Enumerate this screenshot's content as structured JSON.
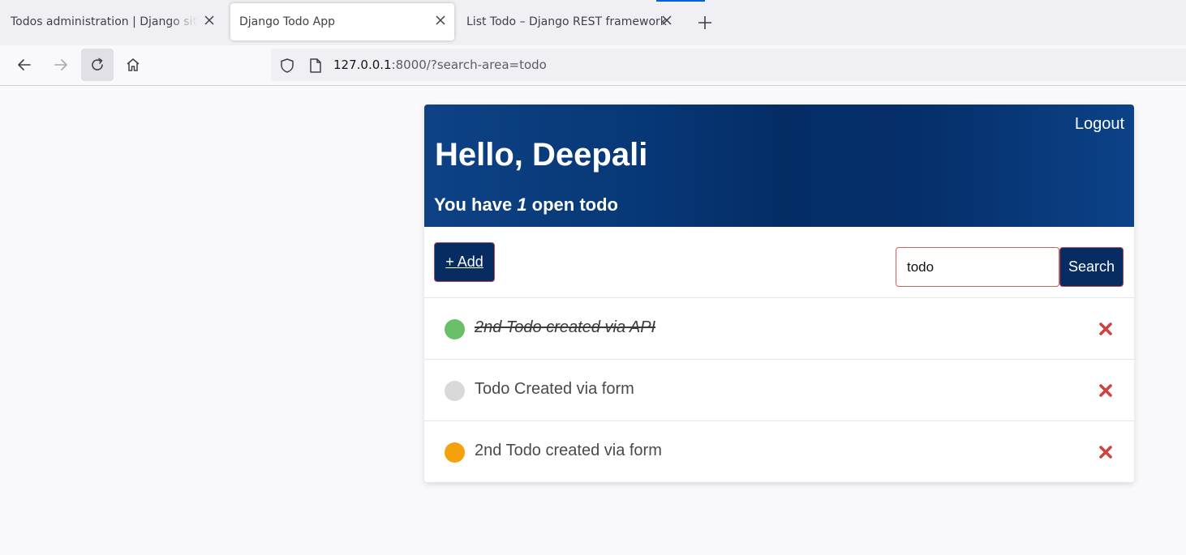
{
  "browser": {
    "tabs": [
      {
        "title": "Todos administration | Django site admin",
        "active": false
      },
      {
        "title": "Django Todo App",
        "active": true
      },
      {
        "title": "List Todo – Django REST framework",
        "active": false
      }
    ],
    "url_host": "127.0.0.1",
    "url_rest": ":8000/?search-area=todo",
    "icons": {
      "back": "arrow-left-icon",
      "forward": "arrow-right-icon",
      "reload": "reload-icon",
      "home": "home-icon",
      "shield": "shield-icon",
      "page": "page-icon",
      "close": "close-icon",
      "new_tab": "plus-icon"
    }
  },
  "header": {
    "logout": "Logout",
    "greeting": "Hello, Deepali",
    "open_prefix": "You have ",
    "open_count": "1",
    "open_suffix": " open todo"
  },
  "toolbar": {
    "add_label": "+ Add",
    "search_value": "todo",
    "search_label": "Search"
  },
  "todos": [
    {
      "title": "2nd Todo created via API",
      "complete": true,
      "status_color": "#6abf69"
    },
    {
      "title": "Todo Created via form",
      "complete": false,
      "status_color": "#d9d9d9"
    },
    {
      "title": "2nd Todo created via form",
      "complete": false,
      "status_color": "#f5a10b"
    }
  ],
  "colors": {
    "header_dark": "#042d66",
    "button": "#062c61",
    "delete": "#d0413f"
  }
}
